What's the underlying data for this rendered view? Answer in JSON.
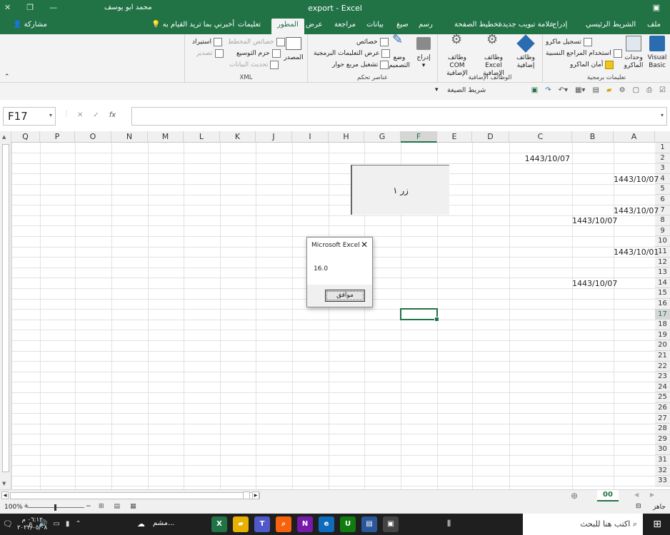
{
  "window": {
    "title": "export  -  Excel",
    "user": "محمد ابو يوسف"
  },
  "tabs": [
    "ملف",
    "الشريط الرئيسي",
    "إدراج",
    "علامة تبويب جديدة",
    "تخطيط الصفحة",
    "رسم",
    "صيغ",
    "بيانات",
    "مراجعة",
    "عرض",
    "المطور",
    "تعليمات"
  ],
  "active_tab": "المطور",
  "tell_me": "أخبرني بما تريد القيام به",
  "share": "مشاركة",
  "ribbon": {
    "code": {
      "label": "تعليمات برمجية",
      "visual_basic": "Visual Basic",
      "macros": "وحدات الماكرو",
      "record_macro": "تسجيل ماكرو",
      "relative_refs": "استخدام المراجع النسبية",
      "macro_security": "أمان الماكرو"
    },
    "addins": {
      "label": "الوظائف الإضافية",
      "addins": "وظائف إضافية",
      "excel_addins": "وظائف Excel الإضافية",
      "com_addins": "وظائف COM الإضافية"
    },
    "controls": {
      "label": "عناصر تحكم",
      "insert": "إدراج",
      "design_mode": "وضع التصميم",
      "properties": "خصائص",
      "view_code": "عرض التعليمات البرمجية",
      "run_dialog": "تشغيل مربع حوار"
    },
    "xml": {
      "label": "XML",
      "source": "المصدر",
      "map_properties": "خصائص المخطط",
      "expansion_packs": "حزم التوسيع",
      "refresh_data": "تحديث البيانات",
      "import": "استيراد",
      "export": "تصدير"
    }
  },
  "qat": {
    "formula_bar": "شريط الصيغة"
  },
  "name_box": "F17",
  "fx": "fx",
  "columns": [
    "A",
    "B",
    "C",
    "D",
    "E",
    "F",
    "G",
    "H",
    "I",
    "J",
    "K",
    "L",
    "M",
    "N",
    "O",
    "P",
    "Q"
  ],
  "rows": [
    "1",
    "2",
    "3",
    "4",
    "5",
    "6",
    "7",
    "8",
    "9",
    "10",
    "11",
    "12",
    "13",
    "14",
    "15",
    "16",
    "17",
    "18",
    "19",
    "20",
    "21",
    "22",
    "23",
    "24",
    "25",
    "26",
    "27",
    "28",
    "29",
    "30",
    "31",
    "32",
    "33"
  ],
  "selected_column": "F",
  "selected_row": "17",
  "cells": [
    {
      "ref": "C2",
      "value": "1443/10/07"
    },
    {
      "ref": "A4",
      "value": "1443/10/07"
    },
    {
      "ref": "A7",
      "value": "1443/10/07"
    },
    {
      "ref": "B8",
      "value": "1443/10/07"
    },
    {
      "ref": "A11",
      "value": "1443/10/01"
    },
    {
      "ref": "B14",
      "value": "1443/10/07"
    }
  ],
  "form_button": "زر ١",
  "msgbox": {
    "title": "Microsoft Excel",
    "message": "16.0",
    "ok": "موافق"
  },
  "sheet_tab": "00",
  "status": {
    "ready": "جاهز",
    "zoom": "100%"
  },
  "taskbar": {
    "search": "اكتب هنا للبحث",
    "running": "مشم...",
    "time": "٠٦:١٢ م",
    "date": "٢٠٢٢/٠٥/٠٨",
    "lang": "ع"
  }
}
